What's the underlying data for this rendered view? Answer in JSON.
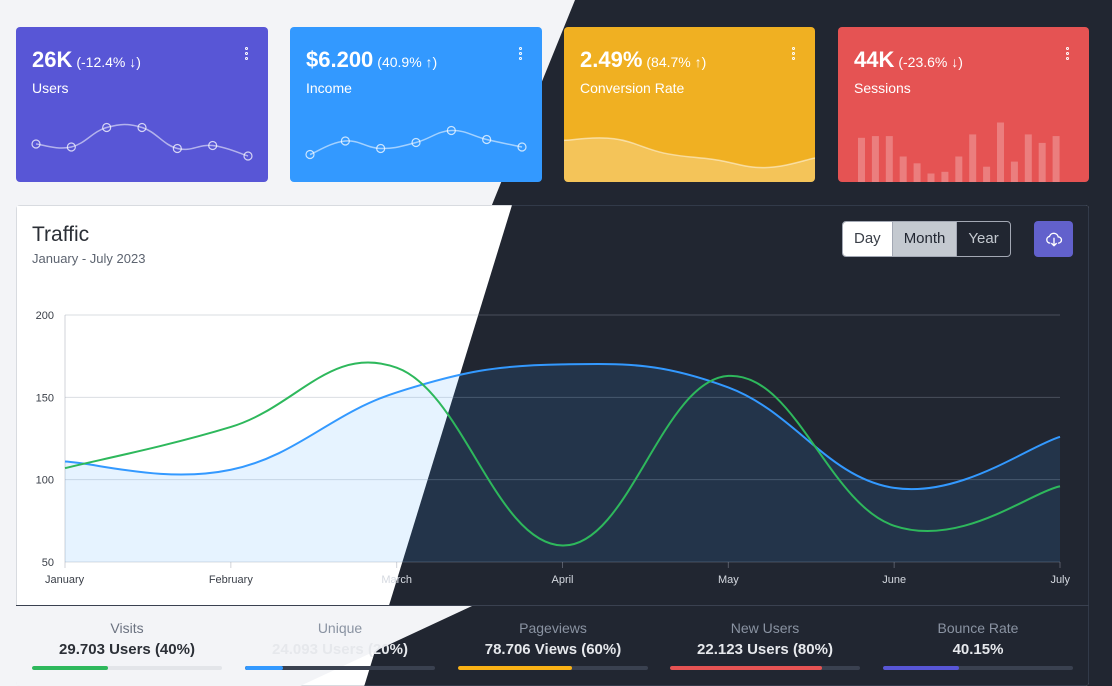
{
  "widgets": [
    {
      "value": "26K",
      "change": "(-12.4% ↓)",
      "title": "Users"
    },
    {
      "value": "$6.200",
      "change": "(40.9% ↑)",
      "title": "Income"
    },
    {
      "value": "2.49%",
      "change": "(84.7% ↑)",
      "title": "Conversion Rate"
    },
    {
      "value": "44K",
      "change": "(-23.6% ↓)",
      "title": "Sessions"
    }
  ],
  "traffic": {
    "title": "Traffic",
    "subtitle": "January - July 2023",
    "periods": [
      "Day",
      "Month",
      "Year"
    ],
    "active_period": "Month"
  },
  "colors": {
    "users": "#5856d6",
    "income": "#3399ff",
    "conversion": "#f0b022",
    "sessions": "#e55353",
    "success": "#2eb85c",
    "info": "#3399ff",
    "warning": "#f9b115",
    "danger": "#e55353",
    "primary": "#5856d6"
  },
  "icons": {
    "widget_menu": "more-vertical-icon",
    "download": "cloud-download-icon"
  },
  "chart_data": {
    "type": "line",
    "categories": [
      "January",
      "February",
      "March",
      "April",
      "May",
      "June",
      "July"
    ],
    "ylim": [
      50,
      200
    ],
    "yticks": [
      50,
      100,
      150,
      200
    ],
    "grid": true,
    "series": [
      {
        "values": [
          111,
          106,
          153,
          170,
          156,
          95,
          126
        ]
      },
      {
        "values": [
          107,
          132,
          168,
          60,
          163,
          72,
          96
        ]
      }
    ]
  },
  "stats": [
    {
      "label": "Visits",
      "value": "29.703 Users (40%)",
      "percent": 40
    },
    {
      "label": "Unique",
      "value": "24.093 Users (20%)",
      "percent": 20
    },
    {
      "label": "Pageviews",
      "value": "78.706 Views (60%)",
      "percent": 60
    },
    {
      "label": "New Users",
      "value": "22.123 Users (80%)",
      "percent": 80
    },
    {
      "label": "Bounce Rate",
      "value": "40.15%",
      "percent": 40
    }
  ],
  "sparklines": {
    "users": [
      40,
      36,
      62,
      62,
      34,
      38,
      24
    ],
    "income": [
      26,
      44,
      34,
      42,
      58,
      46,
      36
    ],
    "conversion": [
      52,
      54,
      36,
      28,
      18,
      30
    ],
    "sessions": [
      52,
      54,
      54,
      30,
      22,
      10,
      12,
      30,
      56,
      18,
      70,
      24,
      56,
      46,
      54
    ]
  }
}
